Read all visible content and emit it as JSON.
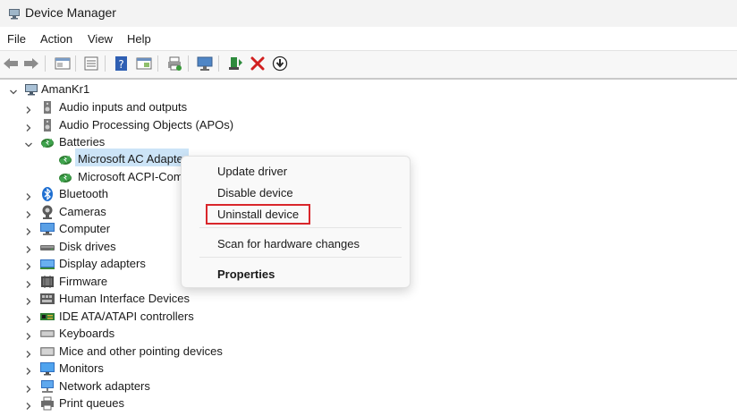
{
  "window": {
    "title": "Device Manager"
  },
  "menu": [
    {
      "label": "File"
    },
    {
      "label": "Action"
    },
    {
      "label": "View"
    },
    {
      "label": "Help"
    }
  ],
  "toolbar": [
    {
      "icon": "back-arrow-icon"
    },
    {
      "icon": "forward-arrow-icon"
    },
    {
      "icon": "properties-window-icon"
    },
    {
      "icon": "list-view-icon"
    },
    {
      "icon": "help-icon"
    },
    {
      "icon": "action-window-icon"
    },
    {
      "icon": "print-icon"
    },
    {
      "icon": "monitor-scan-icon"
    },
    {
      "icon": "add-driver-icon"
    },
    {
      "icon": "uninstall-x-icon"
    },
    {
      "icon": "download-circle-icon"
    }
  ],
  "tree": {
    "root": "AmanKr1",
    "items": [
      {
        "label": "Audio inputs and outputs",
        "icon": "speaker-icon",
        "expanded": false
      },
      {
        "label": "Audio Processing Objects (APOs)",
        "icon": "speaker-icon",
        "expanded": false
      },
      {
        "label": "Batteries",
        "icon": "battery-icon",
        "expanded": true,
        "children": [
          {
            "label": "Microsoft AC Adapter",
            "icon": "battery-icon",
            "selected": true
          },
          {
            "label": "Microsoft ACPI-Compliant Control Method Battery",
            "icon": "battery-icon"
          }
        ]
      },
      {
        "label": "Bluetooth",
        "icon": "bluetooth-icon",
        "expanded": false
      },
      {
        "label": "Cameras",
        "icon": "camera-icon",
        "expanded": false
      },
      {
        "label": "Computer",
        "icon": "computer-icon",
        "expanded": false
      },
      {
        "label": "Disk drives",
        "icon": "disk-drive-icon",
        "expanded": false
      },
      {
        "label": "Display adapters",
        "icon": "display-adapter-icon",
        "expanded": false
      },
      {
        "label": "Firmware",
        "icon": "firmware-icon",
        "expanded": false
      },
      {
        "label": "Human Interface Devices",
        "icon": "hid-icon",
        "expanded": false
      },
      {
        "label": "IDE ATA/ATAPI controllers",
        "icon": "ide-controller-icon",
        "expanded": false
      },
      {
        "label": "Keyboards",
        "icon": "keyboard-icon",
        "expanded": false
      },
      {
        "label": "Mice and other pointing devices",
        "icon": "mouse-icon",
        "expanded": false
      },
      {
        "label": "Monitors",
        "icon": "monitor-icon",
        "expanded": false
      },
      {
        "label": "Network adapters",
        "icon": "network-adapter-icon",
        "expanded": false
      },
      {
        "label": "Print queues",
        "icon": "printer-icon",
        "expanded": false
      }
    ]
  },
  "context_menu": {
    "update_driver": "Update driver",
    "disable_device": "Disable device",
    "uninstall_device": "Uninstall device",
    "scan": "Scan for hardware changes",
    "properties": "Properties"
  },
  "colors": {
    "highlight_box": "#d9262b",
    "selection": "#cce4f7"
  }
}
